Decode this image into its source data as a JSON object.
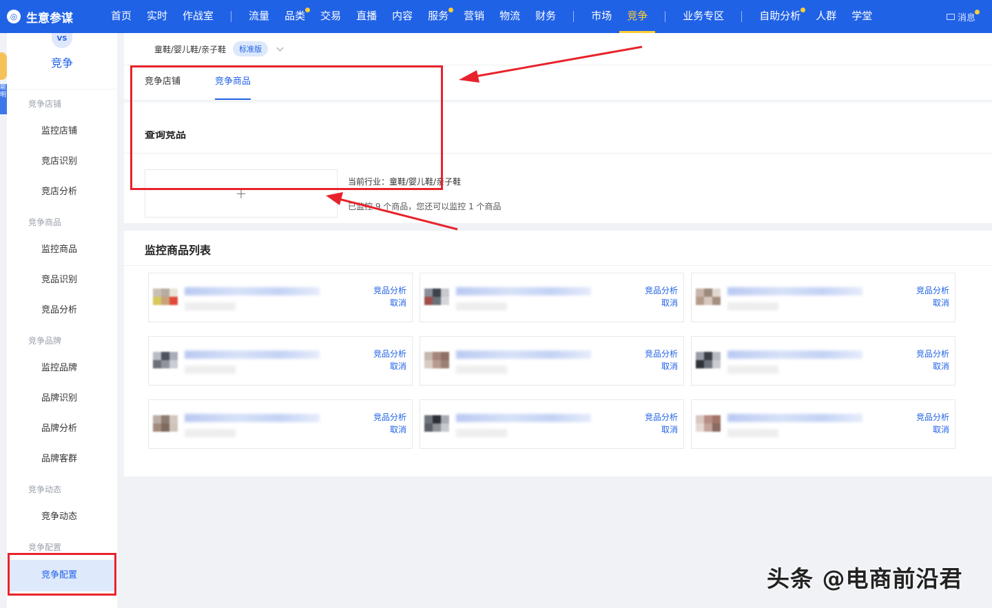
{
  "brand": {
    "logo": "compass-icon",
    "name": "生意参谋"
  },
  "nav": {
    "items": [
      {
        "label": "首页",
        "dot": false
      },
      {
        "label": "实时",
        "dot": false
      },
      {
        "label": "作战室",
        "dot": false
      },
      {
        "label": "流量",
        "dot": false
      },
      {
        "label": "品类",
        "dot": true
      },
      {
        "label": "交易",
        "dot": false
      },
      {
        "label": "直播",
        "dot": false
      },
      {
        "label": "内容",
        "dot": false
      },
      {
        "label": "服务",
        "dot": true
      },
      {
        "label": "营销",
        "dot": false
      },
      {
        "label": "物流",
        "dot": false
      },
      {
        "label": "财务",
        "dot": false
      },
      {
        "label": "市场",
        "dot": false
      },
      {
        "label": "竞争",
        "dot": false,
        "active": true
      },
      {
        "label": "业务专区",
        "dot": false
      },
      {
        "label": "自助分析",
        "dot": true
      },
      {
        "label": "人群",
        "dot": false
      },
      {
        "label": "学堂",
        "dot": false
      }
    ],
    "message": "消息"
  },
  "mascot": {
    "text": "能 明"
  },
  "sidebar": {
    "icon_text": "VS",
    "title": "竞争",
    "groups": {
      "store": {
        "label": "竞争店铺",
        "items": [
          "监控店铺",
          "竞店识别",
          "竞店分析"
        ]
      },
      "product": {
        "label": "竞争商品",
        "items": [
          "监控商品",
          "竞品识别",
          "竞品分析"
        ]
      },
      "brand": {
        "label": "竞争品牌",
        "items": [
          "监控品牌",
          "品牌识别",
          "品牌分析",
          "品牌客群"
        ]
      },
      "dynamic": {
        "label": "竞争动态",
        "items": [
          "竞争动态"
        ]
      },
      "config": {
        "label": "竞争配置",
        "items": [
          "竞争配置"
        ]
      }
    }
  },
  "breadcrumb": {
    "industry": "童鞋/婴儿鞋/亲子鞋",
    "edition": "标准版"
  },
  "tabs": [
    "竞争店铺",
    "竞争商品"
  ],
  "query": {
    "title": "查询竞品",
    "add_symbol": "+",
    "industry_label": "当前行业：童鞋/婴儿鞋/亲子鞋",
    "monitor_note": "已监控 9 个商品，您还可以监控 1 个商品"
  },
  "list": {
    "title": "监控商品列表",
    "analyze_label": "竞品分析",
    "cancel_label": "取消",
    "products": [
      {
        "thumb": [
          "#c9c0b4",
          "#b7aca0",
          "#e8e4d8",
          "#d6c95a",
          "#c9a27c",
          "#e14a3a"
        ]
      },
      {
        "thumb": [
          "#8a8f98",
          "#3e434b",
          "#c6c9ce",
          "#a04e4e",
          "#6c717a",
          "#d5d7da"
        ]
      },
      {
        "thumb": [
          "#c8b6aa",
          "#9d8a7e",
          "#e2d8d2",
          "#b59b8c",
          "#d7c8bf",
          "#a58f82"
        ]
      },
      {
        "thumb": [
          "#b9bcc2",
          "#4f5360",
          "#a9adb6",
          "#6d6f7a",
          "#8f939c",
          "#c9ccd2"
        ]
      },
      {
        "thumb": [
          "#c5b8ae",
          "#a7857a",
          "#8f7066",
          "#d8ccc4",
          "#b89b8f",
          "#9c8076"
        ]
      },
      {
        "thumb": [
          "#9a9ea6",
          "#3c3f46",
          "#b7bac0",
          "#2f3238",
          "#6e727a",
          "#c9ccd1"
        ]
      },
      {
        "thumb": [
          "#b9aea7",
          "#8d7b70",
          "#d2c8c0",
          "#a38b7c",
          "#7f6a5f",
          "#cfc4bb"
        ]
      },
      {
        "thumb": [
          "#6f747c",
          "#2c2f35",
          "#a7abb2",
          "#5a5e66",
          "#8e9299",
          "#c7cacf"
        ]
      },
      {
        "thumb": [
          "#d9c8c2",
          "#b88d84",
          "#a37468",
          "#e6d9d4",
          "#c4a59c",
          "#8a6a62"
        ]
      }
    ]
  },
  "watermark": "头条 @电商前沿君",
  "colors": {
    "primary": "#2062e6",
    "accent": "#ffcf33",
    "annotation": "#e8222b"
  }
}
